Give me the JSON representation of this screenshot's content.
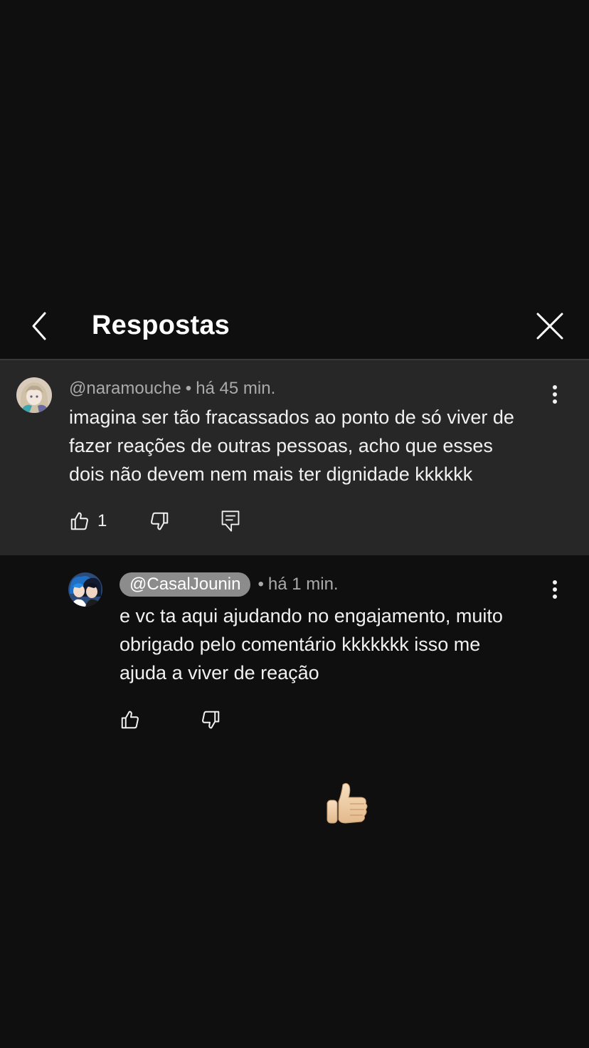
{
  "header": {
    "title": "Respostas",
    "back_icon": "chevron-left-icon",
    "close_icon": "close-icon"
  },
  "parent_comment": {
    "handle": "@naramouche",
    "separator": "•",
    "time": "há 45 min.",
    "lines": [
      "imagina ser tão fracassados ao ponto de só viver de",
      "fazer reações de outras pessoas, acho que esses",
      "dois não devem nem mais ter dignidade kkkkkk"
    ],
    "like_count": "1",
    "icons": [
      "thumbs-up-icon",
      "thumbs-down-icon",
      "reply-icon",
      "more-vertical-icon"
    ]
  },
  "reply": {
    "handle": "@CasalJounin",
    "separator": "•",
    "time": "há 1 min.",
    "lines": [
      "e vc ta aqui ajudando no engajamento, muito",
      "obrigado pelo comentário kkkkkkk isso me",
      "ajuda a viver de reação"
    ],
    "icons": [
      "thumbs-up-icon",
      "thumbs-down-icon",
      "more-vertical-icon"
    ]
  },
  "sticker": {
    "emoji": "thumbs-up-emoji",
    "skin_tone": "#f2d3ad"
  },
  "colors": {
    "background": "#0f0f0f",
    "highlight_bg": "#272727",
    "muted_text": "#aaaaaa",
    "pill_bg": "#8c8c8c"
  }
}
